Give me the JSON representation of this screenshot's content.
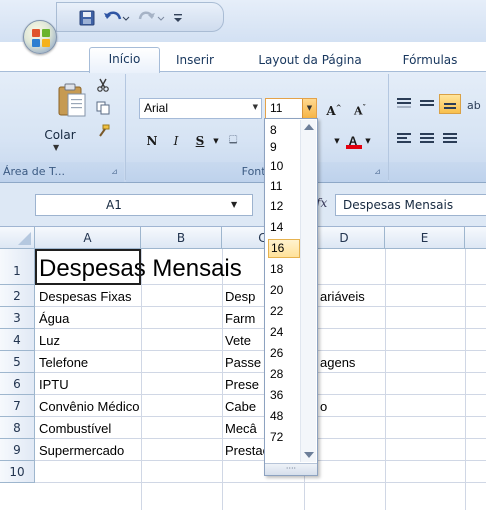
{
  "tabs": [
    "Início",
    "Inserir",
    "Layout da Página",
    "Fórmulas"
  ],
  "ribbon": {
    "paste_label": "Colar",
    "clipboard_group": "Área de T...",
    "font_group": "Fonte",
    "font_name": "Arial",
    "font_size": "11",
    "bold_label": "N",
    "italic_label": "I",
    "underline_label": "S",
    "grow_label": "A",
    "shrink_label": "A",
    "font_color_label": "A"
  },
  "formula_bar": {
    "name_box": "A1",
    "fx_label": "fx",
    "formula": "Despesas Mensais"
  },
  "columns": [
    "A",
    "B",
    "C",
    "D",
    "E"
  ],
  "rows": [
    "1",
    "2",
    "3",
    "4",
    "5",
    "6",
    "7",
    "8",
    "9",
    "10"
  ],
  "cells": {
    "r1_a": "Despesas Mensais",
    "r2_a": "Despesas Fixas",
    "r2_c": "Desp",
    "r2_d": "ariáveis",
    "r3_a": "Água",
    "r3_c": "Farm",
    "r4_a": "Luz",
    "r4_c": "Vete",
    "r5_a": "Telefone",
    "r5_c": "Passe",
    "r5_d": "agens",
    "r6_a": "IPTU",
    "r6_c": "Prese",
    "r7_a": "Convênio Médico",
    "r7_c": "Cabe",
    "r7_d": "o",
    "r8_a": "Combustível",
    "r8_c": "Mecâ",
    "r9_a": "Supermercado",
    "r9_c": "Prestações"
  },
  "font_sizes": [
    "8",
    "9",
    "10",
    "11",
    "12",
    "14",
    "16",
    "18",
    "20",
    "22",
    "24",
    "26",
    "28",
    "36",
    "48",
    "72"
  ],
  "highlighted_size": "16",
  "colors": {
    "accent_highlight": "#ffe29a",
    "ribbon_bg": "#d7e4f4",
    "font_color_swatch": "#e3000f"
  }
}
